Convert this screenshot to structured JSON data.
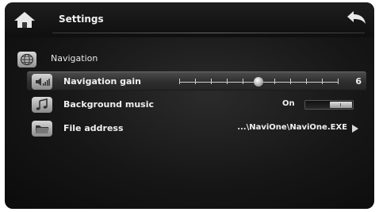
{
  "header": {
    "title": "Settings",
    "home_icon": "home-icon",
    "back_icon": "back-arrow-icon"
  },
  "section": {
    "label": "Navigation",
    "icon": "globe-icon"
  },
  "rows": [
    {
      "label": "Navigation gain",
      "icon": "volume-bars-icon",
      "control": "slider",
      "value": "6",
      "slider_level": 0.5,
      "slider_ticks": 10
    },
    {
      "label": "Background music",
      "icon": "music-note-icon",
      "control": "toggle",
      "state": "On"
    },
    {
      "label": "File address",
      "icon": "folder-icon",
      "control": "link",
      "value": "...\\NaviOne\\NaviOne.EXE",
      "arrow_icon": "arrow-right-icon"
    }
  ],
  "colors": {
    "background": "#161616",
    "text": "#f0f0f0",
    "selected_row": "#3a3a3a"
  }
}
